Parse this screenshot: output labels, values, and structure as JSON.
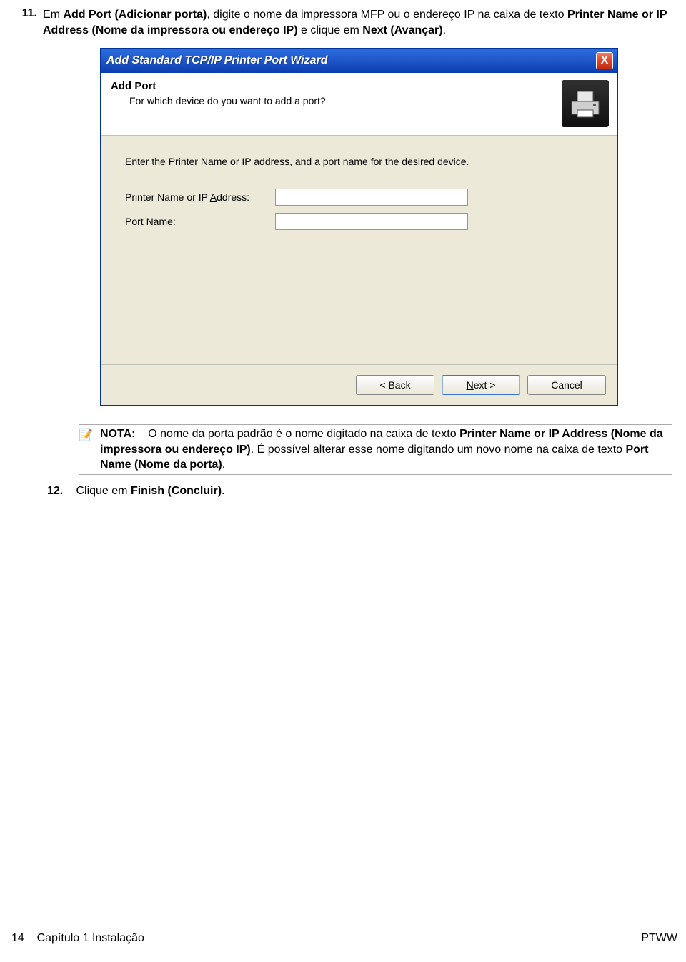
{
  "step11": {
    "number": "11.",
    "part1": "Em ",
    "bold1": "Add Port (Adicionar porta)",
    "part2": ", digite o nome da impressora MFP ou o endereço IP na caixa de texto ",
    "bold2": "Printer Name or IP Address (Nome da impressora ou endereço IP)",
    "part3": " e clique em ",
    "bold3": "Next (Avançar)",
    "part4": "."
  },
  "wizard": {
    "title": "Add Standard TCP/IP Printer Port Wizard",
    "close_label": "X",
    "header_title": "Add Port",
    "header_sub": "For which device do you want to add a port?",
    "instruction": "Enter the Printer Name or IP address, and a port name for the desired device.",
    "label_printer_pre": "Printer Name or IP ",
    "label_printer_u": "A",
    "label_printer_post": "ddress:",
    "label_port_u": "P",
    "label_port_post": "ort Name:",
    "back_label": "< Back",
    "next_pre": "",
    "next_u": "N",
    "next_post": "ext >",
    "cancel_label": "Cancel"
  },
  "note": {
    "icon": "📝",
    "label": "NOTA:",
    "part1": "O nome da porta padrão é o nome digitado na caixa de texto ",
    "bold1": "Printer Name or IP Address (Nome da impressora ou endereço IP)",
    "part2": ". É possível alterar esse nome digitando um novo nome na caixa de texto ",
    "bold2": "Port Name (Nome da porta)",
    "part3": "."
  },
  "step12": {
    "number": "12.",
    "part1": "Clique em ",
    "bold1": "Finish (Concluir)",
    "part2": "."
  },
  "footer": {
    "page": "14",
    "chapter": "Capítulo 1   Instalação",
    "right": "PTWW"
  }
}
